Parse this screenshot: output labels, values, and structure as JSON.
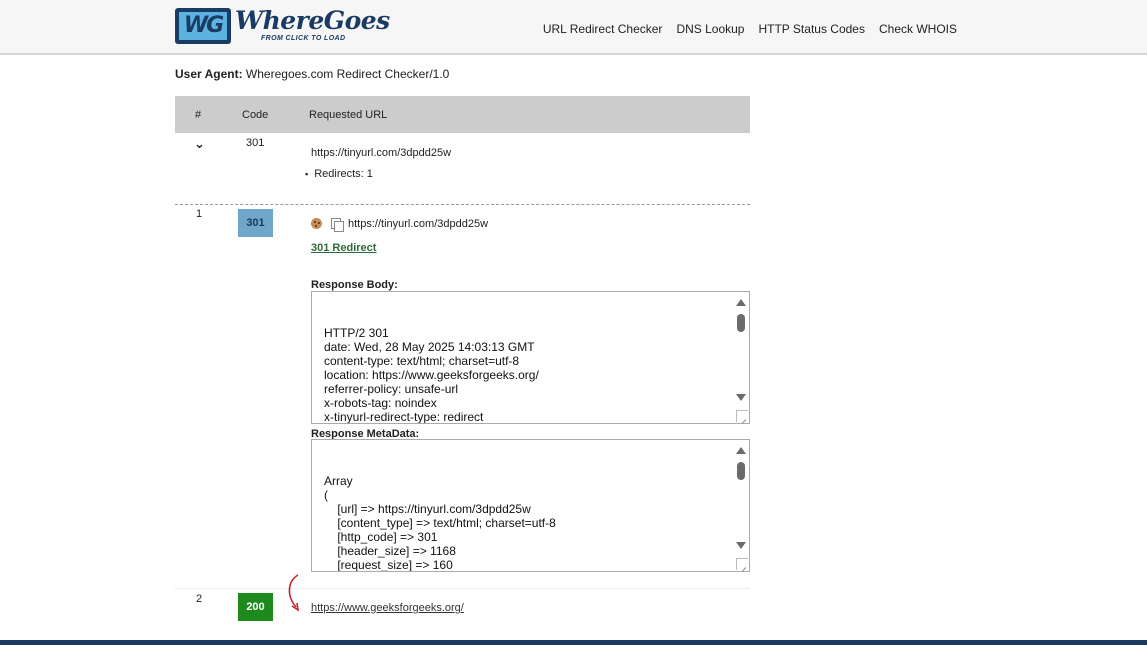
{
  "brand": {
    "logo_mark": "WG",
    "name": "WhereGoes",
    "tagline": "FROM CLICK TO LOAD",
    "color": "#1a3b63"
  },
  "nav": {
    "items": [
      "URL Redirect Checker",
      "DNS Lookup",
      "HTTP Status Codes",
      "Check WHOIS"
    ]
  },
  "user_agent": {
    "label": "User Agent:",
    "value": "Wheregoes.com Redirect Checker/1.0"
  },
  "table": {
    "headers": [
      "#",
      "Code",
      "Requested URL"
    ],
    "summary": {
      "toggle_icon": "chevron-down-icon",
      "toggle": "⌄",
      "code": "301",
      "url": "https://tinyurl.com/3dpdd25w",
      "redirects": "Redirects: 1"
    },
    "rows": [
      {
        "num": "1",
        "code": "301",
        "code_color": "#6fa6c9",
        "url": "https://tinyurl.com/3dpdd25w",
        "status_link": "301 Redirect",
        "response_body_label": "Response Body:",
        "response_body": "HTTP/2 301\ndate: Wed, 28 May 2025 14:03:13 GMT\ncontent-type: text/html; charset=utf-8\nlocation: https://www.geeksforgeeks.org/\nreferrer-policy: unsafe-url\nx-robots-tag: noindex\nx-tinyurl-redirect-type: redirect",
        "response_meta_label": "Response MetaData:",
        "response_meta": "Array\n(\n    [url] => https://tinyurl.com/3dpdd25w\n    [content_type] => text/html; charset=utf-8\n    [http_code] => 301\n    [header_size] => 1168\n    [request_size] => 160"
      },
      {
        "num": "2",
        "code": "200",
        "code_color": "#1e8a1e",
        "url": "https://www.geeksforgeeks.org/"
      }
    ]
  }
}
